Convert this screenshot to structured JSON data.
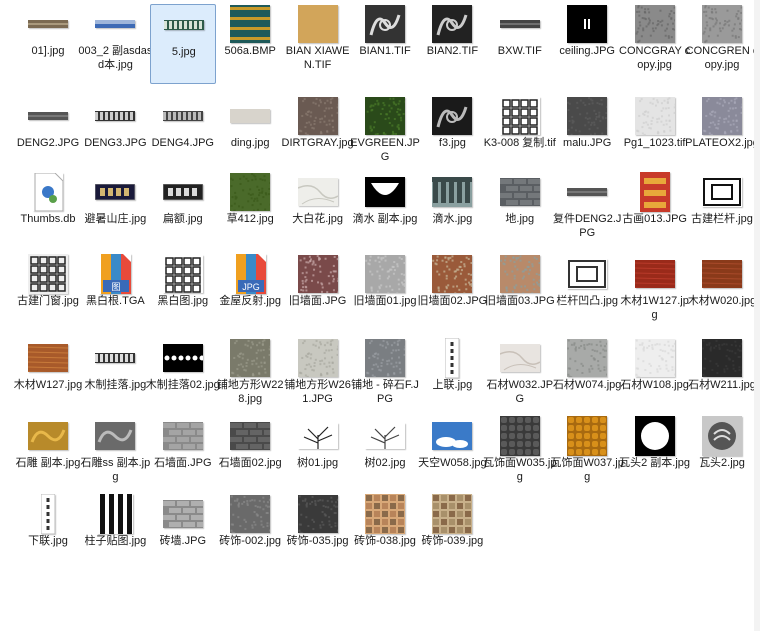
{
  "items": [
    {
      "label": "01].jpg",
      "icon": "image-thumbnail",
      "colors": [
        "#7b6a52",
        "#d8c8a8"
      ],
      "type": "strip-stone"
    },
    {
      "label": "003_2 副asdasd本.jpg",
      "icon": "image-thumbnail",
      "colors": [
        "#3d6ab5",
        "#ffffff"
      ],
      "type": "strip-sky"
    },
    {
      "label": "5.jpg",
      "icon": "image-thumbnail",
      "colors": [
        "#2e5b4a",
        "#d8e4d8"
      ],
      "type": "strip-pattern",
      "selected": true
    },
    {
      "label": "506a.BMP",
      "icon": "image-thumbnail",
      "colors": [
        "#1e5a5a",
        "#c89a2a"
      ],
      "type": "pattern"
    },
    {
      "label": "BIAN XIAWEN.TIF",
      "icon": "image-thumbnail",
      "colors": [
        "#d2a55a",
        "#b08030"
      ],
      "type": "solid"
    },
    {
      "label": "BIAN1.TIF",
      "icon": "image-thumbnail",
      "colors": [
        "#333333",
        "#dddddd"
      ],
      "type": "dragon"
    },
    {
      "label": "BIAN2.TIF",
      "icon": "image-thumbnail",
      "colors": [
        "#222222",
        "#cccccc"
      ],
      "type": "dragon"
    },
    {
      "label": "BXW.TIF",
      "icon": "image-thumbnail",
      "colors": [
        "#444444",
        "#999999"
      ],
      "type": "strip-dark"
    },
    {
      "label": "ceiling.JPG",
      "icon": "image-thumbnail",
      "colors": [
        "#000000",
        "#ffffff"
      ],
      "type": "ceiling"
    },
    {
      "label": "CONCGRAY copy.jpg",
      "icon": "image-thumbnail",
      "colors": [
        "#8a8a8a",
        "#666666"
      ],
      "type": "noise"
    },
    {
      "label": "CONCGREN copy.jpg",
      "icon": "image-thumbnail",
      "colors": [
        "#9a9a9a",
        "#777777"
      ],
      "type": "noise"
    },
    {
      "label": "DENG2.JPG",
      "icon": "image-thumbnail",
      "colors": [
        "#555555",
        "#999999"
      ],
      "type": "strip-dark"
    },
    {
      "label": "DENG3.JPG",
      "icon": "image-thumbnail",
      "colors": [
        "#333333",
        "#cccccc"
      ],
      "type": "strip-pattern"
    },
    {
      "label": "DENG4.JPG",
      "icon": "image-thumbnail",
      "colors": [
        "#444444",
        "#bbbbbb"
      ],
      "type": "strip-pattern"
    },
    {
      "label": "ding.jpg",
      "icon": "image-thumbnail",
      "colors": [
        "#d8d4cc",
        "#ece8e0"
      ],
      "type": "strip-light"
    },
    {
      "label": "DIRTGRAY.jpg",
      "icon": "image-thumbnail",
      "colors": [
        "#6a5a52",
        "#8a7a70"
      ],
      "type": "noise"
    },
    {
      "label": "EVGREEN.JPG",
      "icon": "image-thumbnail",
      "colors": [
        "#2a4a1a",
        "#4a7a2a"
      ],
      "type": "noise"
    },
    {
      "label": "f3.jpg",
      "icon": "image-thumbnail",
      "colors": [
        "#1a1a1a",
        "#bbbbbb"
      ],
      "type": "dragon"
    },
    {
      "label": "K3-008 复制.tif",
      "icon": "image-thumbnail",
      "colors": [
        "#ffffff",
        "#222222"
      ],
      "type": "lattice"
    },
    {
      "label": "malu.JPG",
      "icon": "image-thumbnail",
      "colors": [
        "#4a4a4a",
        "#5c5c5c"
      ],
      "type": "noise"
    },
    {
      "label": "Pg1_1023.tif",
      "icon": "image-thumbnail",
      "colors": [
        "#e4e4e4",
        "#cfcfcf"
      ],
      "type": "noise"
    },
    {
      "label": "PLATEOX2.jpg",
      "icon": "image-thumbnail",
      "colors": [
        "#8a8a9a",
        "#a8a8b8"
      ],
      "type": "noise"
    },
    {
      "label": "Thumbs.db",
      "icon": "settings-file-icon",
      "colors": [
        "#ffffff",
        "#3a78c8"
      ],
      "type": "file-settings"
    },
    {
      "label": "避暑山庄.jpg",
      "icon": "image-thumbnail",
      "colors": [
        "#1a1a3a",
        "#e8c878"
      ],
      "type": "plaque"
    },
    {
      "label": "扁额.jpg",
      "icon": "image-thumbnail",
      "colors": [
        "#222222",
        "#eeeeee"
      ],
      "type": "plaque-dark"
    },
    {
      "label": "草412.jpg",
      "icon": "image-thumbnail",
      "colors": [
        "#4a6a2a",
        "#3a5a1a"
      ],
      "type": "noise"
    },
    {
      "label": "大白花.jpg",
      "icon": "image-thumbnail",
      "colors": [
        "#eeeeea",
        "#c8c8c0"
      ],
      "type": "marble"
    },
    {
      "label": "滴水 副本.jpg",
      "icon": "image-thumbnail",
      "colors": [
        "#000000",
        "#ffffff"
      ],
      "type": "drip"
    },
    {
      "label": "滴水.jpg",
      "icon": "image-thumbnail",
      "colors": [
        "#3a4a4a",
        "#8aa0a0"
      ],
      "type": "roof"
    },
    {
      "label": "地.jpg",
      "icon": "image-thumbnail",
      "colors": [
        "#5a5e62",
        "#7a7e82"
      ],
      "type": "brick"
    },
    {
      "label": "复件DENG2.JPG",
      "icon": "image-thumbnail",
      "colors": [
        "#555555",
        "#999999"
      ],
      "type": "strip-dark"
    },
    {
      "label": "古画013.JPG",
      "icon": "image-thumbnail",
      "colors": [
        "#c83a2a",
        "#e8a83a"
      ],
      "type": "painting"
    },
    {
      "label": "古建栏杆.jpg",
      "icon": "image-thumbnail",
      "colors": [
        "#ffffff",
        "#111111"
      ],
      "type": "railing"
    },
    {
      "label": "古建门窗.jpg",
      "icon": "image-thumbnail",
      "colors": [
        "#eeeeee",
        "#222222"
      ],
      "type": "lattice-grid"
    },
    {
      "label": "黑白根.TGA",
      "icon": "image-file-icon",
      "colors": [
        "#e84a3a",
        "#3a8ac8"
      ],
      "type": "file-color",
      "badge": "图"
    },
    {
      "label": "黑白图.jpg",
      "icon": "image-thumbnail",
      "colors": [
        "#ffffff",
        "#222222"
      ],
      "type": "lattice"
    },
    {
      "label": "金屋反射.jpg",
      "icon": "image-file-icon",
      "colors": [
        "#e84a3a",
        "#3a8ac8"
      ],
      "type": "file-color",
      "badge": "JPG"
    },
    {
      "label": "旧墙面.JPG",
      "icon": "image-thumbnail",
      "colors": [
        "#7a4a4a",
        "#c8a8a8"
      ],
      "type": "noise"
    },
    {
      "label": "旧墙面01.jpg",
      "icon": "image-thumbnail",
      "colors": [
        "#a8a8a8",
        "#c8c8c8"
      ],
      "type": "noise"
    },
    {
      "label": "旧墙面02.JPG",
      "icon": "image-thumbnail",
      "colors": [
        "#9a5a3a",
        "#c8b89a"
      ],
      "type": "noise"
    },
    {
      "label": "旧墙面03.JPG",
      "icon": "image-thumbnail",
      "colors": [
        "#b88a6a",
        "#8aa0a0"
      ],
      "type": "noise"
    },
    {
      "label": "栏杆凹凸.jpg",
      "icon": "image-thumbnail",
      "colors": [
        "#ffffff",
        "#333333"
      ],
      "type": "railing"
    },
    {
      "label": "木材1W127.jpg",
      "icon": "image-thumbnail",
      "colors": [
        "#9a2a1a",
        "#b83a2a"
      ],
      "type": "wood"
    },
    {
      "label": "木材W020.jpg",
      "icon": "image-thumbnail",
      "colors": [
        "#8a3a1a",
        "#a84a2a"
      ],
      "type": "wood"
    },
    {
      "label": "木材W127.jpg",
      "icon": "image-thumbnail",
      "colors": [
        "#a85a2a",
        "#c87a3a"
      ],
      "type": "wood"
    },
    {
      "label": "木制挂落.jpg",
      "icon": "image-thumbnail",
      "colors": [
        "#333333",
        "#dddddd"
      ],
      "type": "strip-pattern"
    },
    {
      "label": "木制挂落02.jpg",
      "icon": "image-thumbnail",
      "colors": [
        "#000000",
        "#ffffff"
      ],
      "type": "lace"
    },
    {
      "label": "铺地方形W228.jpg",
      "icon": "image-thumbnail",
      "colors": [
        "#7a7a6a",
        "#9a9a8a"
      ],
      "type": "noise"
    },
    {
      "label": "铺地方形W261.JPG",
      "icon": "image-thumbnail",
      "colors": [
        "#c8c8c0",
        "#a8a8a0"
      ],
      "type": "noise"
    },
    {
      "label": "铺地 - 碎石F.JPG",
      "icon": "image-thumbnail",
      "colors": [
        "#7a7e82",
        "#9a9ea2"
      ],
      "type": "noise"
    },
    {
      "label": "上联.jpg",
      "icon": "image-thumbnail",
      "colors": [
        "#ffffff",
        "#333333"
      ],
      "type": "couplet"
    },
    {
      "label": "石材W032.JPG",
      "icon": "image-thumbnail",
      "colors": [
        "#e8e4e0",
        "#c8c0b8"
      ],
      "type": "marble"
    },
    {
      "label": "石材W074.jpg",
      "icon": "image-thumbnail",
      "colors": [
        "#a8aaa8",
        "#888a88"
      ],
      "type": "noise"
    },
    {
      "label": "石材W108.jpg",
      "icon": "image-thumbnail",
      "colors": [
        "#eeeeee",
        "#d8d8d8"
      ],
      "type": "noise"
    },
    {
      "label": "石材W211.jpg",
      "icon": "image-thumbnail",
      "colors": [
        "#2a2a2a",
        "#3a3a3a"
      ],
      "type": "noise"
    },
    {
      "label": "石雕 副本.jpg",
      "icon": "image-thumbnail",
      "colors": [
        "#b88a2a",
        "#e8b84a"
      ],
      "type": "carving"
    },
    {
      "label": "石雕ss 副本.jpg",
      "icon": "image-thumbnail",
      "colors": [
        "#6a6a6a",
        "#bbbbbb"
      ],
      "type": "carving"
    },
    {
      "label": "石墙面.JPG",
      "icon": "image-thumbnail",
      "colors": [
        "#8a8a8a",
        "#aaaaaa"
      ],
      "type": "brick"
    },
    {
      "label": "石墙面02.jpg",
      "icon": "image-thumbnail",
      "colors": [
        "#4a4a4a",
        "#6a6a6a"
      ],
      "type": "brick"
    },
    {
      "label": "树01.jpg",
      "icon": "image-thumbnail",
      "colors": [
        "#ffffff",
        "#222222"
      ],
      "type": "tree"
    },
    {
      "label": "树02.jpg",
      "icon": "image-thumbnail",
      "colors": [
        "#ffffff",
        "#444444"
      ],
      "type": "tree"
    },
    {
      "label": "天空W058.jpg",
      "icon": "image-thumbnail",
      "colors": [
        "#3a7ac8",
        "#ffffff"
      ],
      "type": "sky"
    },
    {
      "label": "瓦饰面W035.jpg",
      "icon": "image-thumbnail",
      "colors": [
        "#5a5a5a",
        "#3a3a3a"
      ],
      "type": "tiles"
    },
    {
      "label": "瓦饰面W037.jpg",
      "icon": "image-thumbnail",
      "colors": [
        "#d8901a",
        "#a86a10"
      ],
      "type": "tiles"
    },
    {
      "label": "瓦头2 副本.jpg",
      "icon": "image-thumbnail",
      "colors": [
        "#000000",
        "#ffffff"
      ],
      "type": "circle"
    },
    {
      "label": "瓦头2.jpg",
      "icon": "image-thumbnail",
      "colors": [
        "#c8c8c8",
        "#555555"
      ],
      "type": "circle-gray"
    },
    {
      "label": "下联.jpg",
      "icon": "image-thumbnail",
      "colors": [
        "#ffffff",
        "#333333"
      ],
      "type": "couplet"
    },
    {
      "label": "柱子贴图.jpg",
      "icon": "image-thumbnail",
      "colors": [
        "#ffffff",
        "#111111"
      ],
      "type": "columns"
    },
    {
      "label": "砖墙.JPG",
      "icon": "image-thumbnail",
      "colors": [
        "#8a8a8a",
        "#b8b8b8"
      ],
      "type": "brick"
    },
    {
      "label": "砖饰-002.jpg",
      "icon": "image-thumbnail",
      "colors": [
        "#6a6a6a",
        "#8a8a8a"
      ],
      "type": "noise"
    },
    {
      "label": "砖饰-035.jpg",
      "icon": "image-thumbnail",
      "colors": [
        "#3a3a3a",
        "#5a5a5a"
      ],
      "type": "noise"
    },
    {
      "label": "砖饰-038.jpg",
      "icon": "image-thumbnail",
      "colors": [
        "#b8845a",
        "#d8a878"
      ],
      "type": "mosaic"
    },
    {
      "label": "砖饰-039.jpg",
      "icon": "image-thumbnail",
      "colors": [
        "#a8906a",
        "#c8b08a"
      ],
      "type": "mosaic"
    }
  ]
}
